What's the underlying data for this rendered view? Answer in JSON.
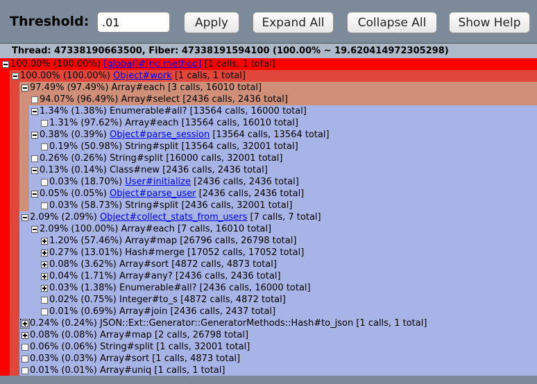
{
  "toolbar": {
    "threshold_label": "Threshold:",
    "threshold_value": ".01",
    "apply_label": "Apply",
    "expand_all_label": "Expand All",
    "collapse_all_label": "Collapse All",
    "show_help_label": "Show Help"
  },
  "thread_header": "Thread: 47338190663500, Fiber: 47338191594100 (100.00% ~ 19.620414972305298)",
  "colors": {
    "level0": "#ff0000",
    "level1": "#e0463a",
    "level2": "#cf8f78",
    "level3": "#a8b4e6",
    "level4": "#a8b4e6",
    "link": "#0000ee"
  },
  "rows": [
    {
      "depth": 0,
      "toggle": "minus",
      "color": "level0",
      "pct": "100.00% (100.00%)",
      "method": "[global]#[no method]",
      "link": true,
      "stats": "[1 calls, 1 total]"
    },
    {
      "depth": 1,
      "toggle": "minus",
      "color": "level1",
      "pct": "100.00% (100.00%)",
      "method": "Object#work",
      "link": true,
      "stats": "[1 calls, 1 total]"
    },
    {
      "depth": 2,
      "toggle": "minus",
      "color": "level2",
      "pct": "97.49% (97.49%)",
      "method": "Array#each",
      "link": false,
      "stats": "[3 calls, 16010 total]"
    },
    {
      "depth": 3,
      "toggle": "leaf",
      "color": "level2",
      "pct": "94.07% (96.49%)",
      "method": "Array#select",
      "link": false,
      "stats": "[2436 calls, 2436 total]"
    },
    {
      "depth": 3,
      "toggle": "minus",
      "color": "level3",
      "pct": "1.34% (1.38%)",
      "method": "Enumerable#all?",
      "link": false,
      "stats": "[13564 calls, 16000 total]"
    },
    {
      "depth": 4,
      "toggle": "leaf",
      "color": "level3",
      "pct": "1.31% (97.62%)",
      "method": "Array#each",
      "link": false,
      "stats": "[13564 calls, 16010 total]"
    },
    {
      "depth": 3,
      "toggle": "minus",
      "color": "level3",
      "pct": "0.38% (0.39%)",
      "method": "Object#parse_session",
      "link": true,
      "stats": "[13564 calls, 13564 total]"
    },
    {
      "depth": 4,
      "toggle": "leaf",
      "color": "level3",
      "pct": "0.19% (50.98%)",
      "method": "String#split",
      "link": false,
      "stats": "[13564 calls, 32001 total]"
    },
    {
      "depth": 3,
      "toggle": "leaf",
      "color": "level3",
      "pct": "0.26% (0.26%)",
      "method": "String#split",
      "link": false,
      "stats": "[16000 calls, 32001 total]"
    },
    {
      "depth": 3,
      "toggle": "minus",
      "color": "level3",
      "pct": "0.13% (0.14%)",
      "method": "Class#new",
      "link": false,
      "stats": "[2436 calls, 2436 total]"
    },
    {
      "depth": 4,
      "toggle": "leaf",
      "color": "level3",
      "pct": "0.03% (18.70%)",
      "method": "User#initialize",
      "link": true,
      "stats": "[2436 calls, 2436 total]"
    },
    {
      "depth": 3,
      "toggle": "minus",
      "color": "level3",
      "pct": "0.05% (0.05%)",
      "method": "Object#parse_user",
      "link": true,
      "stats": "[2436 calls, 2436 total]"
    },
    {
      "depth": 4,
      "toggle": "leaf",
      "color": "level3",
      "pct": "0.03% (58.73%)",
      "method": "String#split",
      "link": false,
      "stats": "[2436 calls, 32001 total]"
    },
    {
      "depth": 2,
      "toggle": "minus",
      "color": "level3",
      "pct": "2.09% (2.09%)",
      "method": "Object#collect_stats_from_users",
      "link": true,
      "stats": "[7 calls, 7 total]"
    },
    {
      "depth": 3,
      "toggle": "minus",
      "color": "level3",
      "pct": "2.09% (100.00%)",
      "method": "Array#each",
      "link": false,
      "stats": "[7 calls, 16010 total]"
    },
    {
      "depth": 4,
      "toggle": "plus",
      "color": "level3",
      "pct": "1.20% (57.46%)",
      "method": "Array#map",
      "link": false,
      "stats": "[26796 calls, 26798 total]"
    },
    {
      "depth": 4,
      "toggle": "plus",
      "color": "level3",
      "pct": "0.27% (13.01%)",
      "method": "Hash#merge",
      "link": false,
      "stats": "[17052 calls, 17052 total]"
    },
    {
      "depth": 4,
      "toggle": "plus",
      "color": "level3",
      "pct": "0.08% (3.62%)",
      "method": "Array#sort",
      "link": false,
      "stats": "[4872 calls, 4873 total]"
    },
    {
      "depth": 4,
      "toggle": "plus",
      "color": "level3",
      "pct": "0.04% (1.71%)",
      "method": "Array#any?",
      "link": false,
      "stats": "[2436 calls, 2436 total]"
    },
    {
      "depth": 4,
      "toggle": "plus",
      "color": "level3",
      "pct": "0.03% (1.38%)",
      "method": "Enumerable#all?",
      "link": false,
      "stats": "[2436 calls, 16000 total]"
    },
    {
      "depth": 4,
      "toggle": "leaf",
      "color": "level3",
      "pct": "0.02% (0.75%)",
      "method": "Integer#to_s",
      "link": false,
      "stats": "[4872 calls, 4872 total]"
    },
    {
      "depth": 4,
      "toggle": "leaf",
      "color": "level3",
      "pct": "0.01% (0.69%)",
      "method": "Array#join",
      "link": false,
      "stats": "[2436 calls, 2437 total]"
    },
    {
      "depth": 2,
      "toggle": "plus",
      "color": "level3",
      "pct": "0.24% (0.24%)",
      "method": "JSON::Ext::Generator::GeneratorMethods::Hash#to_json",
      "link": false,
      "stats": "[1 calls, 1 total]",
      "focused": true
    },
    {
      "depth": 2,
      "toggle": "plus",
      "color": "level3",
      "pct": "0.08% (0.08%)",
      "method": "Array#map",
      "link": false,
      "stats": "[2 calls, 26798 total]"
    },
    {
      "depth": 2,
      "toggle": "leaf",
      "color": "level3",
      "pct": "0.06% (0.06%)",
      "method": "String#split",
      "link": false,
      "stats": "[1 calls, 32001 total]"
    },
    {
      "depth": 2,
      "toggle": "leaf",
      "color": "level3",
      "pct": "0.03% (0.03%)",
      "method": "Array#sort",
      "link": false,
      "stats": "[1 calls, 4873 total]"
    },
    {
      "depth": 2,
      "toggle": "leaf",
      "color": "level3",
      "pct": "0.01% (0.01%)",
      "method": "Array#uniq",
      "link": false,
      "stats": "[1 calls, 1 total]"
    }
  ]
}
